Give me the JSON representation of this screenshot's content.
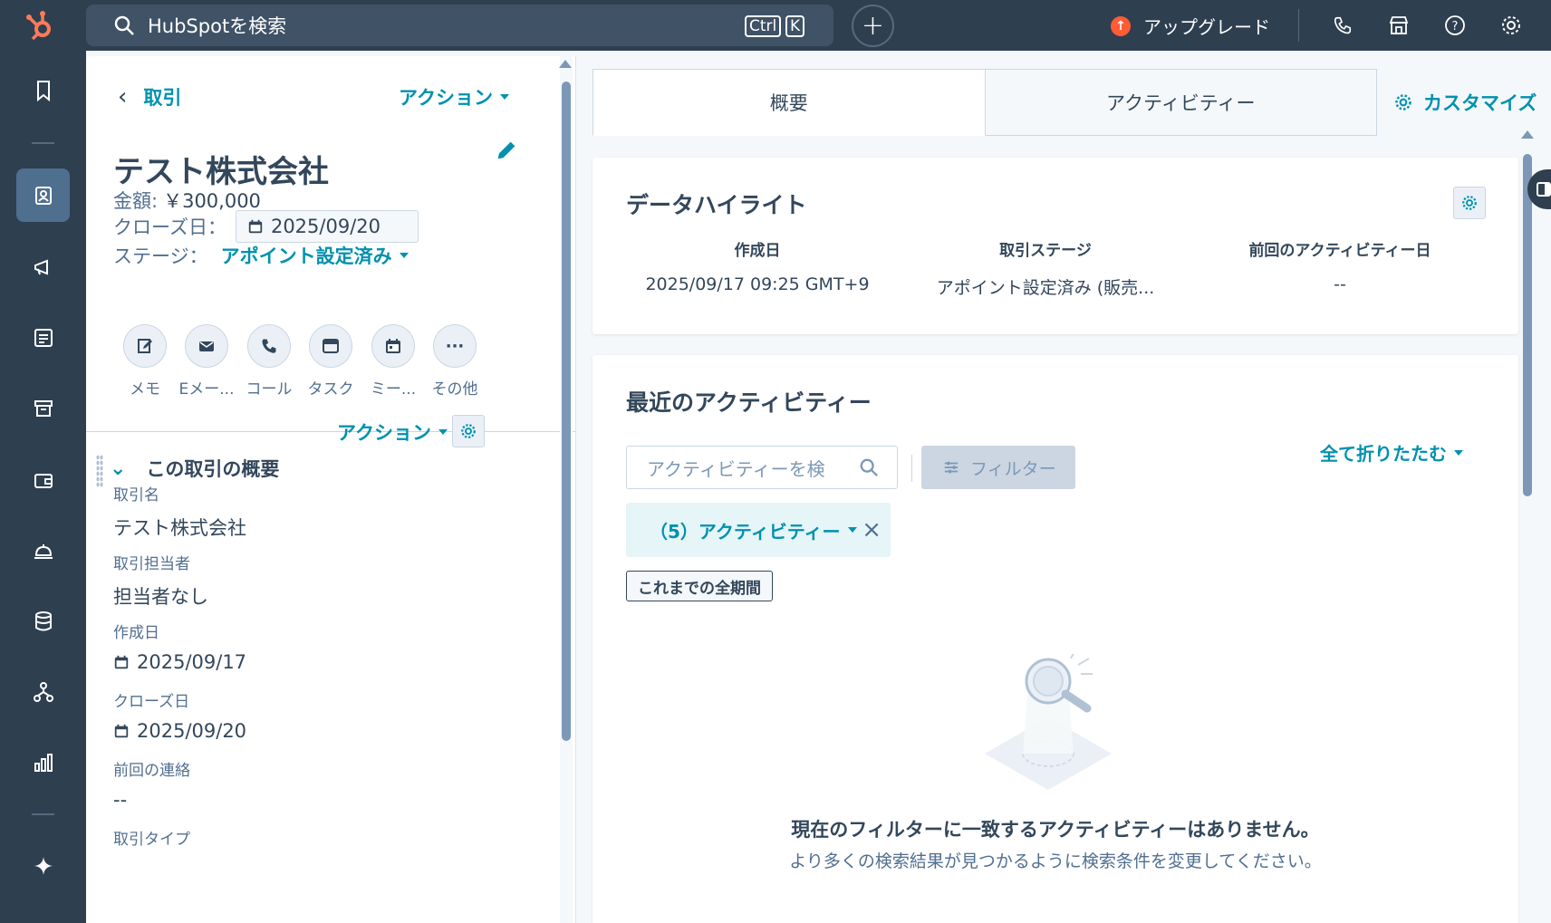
{
  "topbar": {
    "search_text": "HubSpotを検索",
    "kbd_ctrl": "Ctrl",
    "kbd_k": "K",
    "plus": "+",
    "upgrade_label": "アップグレード",
    "upgrade_symbol": "↑"
  },
  "icons": {
    "logo": "hubspot-sprocket-icon",
    "rail": [
      "bookmark-icon",
      "contacts-icon",
      "marketing-megaphone-icon",
      "content-icon",
      "commerce-icon",
      "sales-wallet-icon",
      "service-bell-icon",
      "data-database-icon",
      "automation-icon",
      "reporting-chart-icon",
      "ai-sparkle-icon"
    ]
  },
  "left": {
    "back_label": "取引",
    "back_chevron": "‹",
    "actions_label": "アクション",
    "title": "テスト株式会社",
    "amount_label": "金額:",
    "amount_value": "￥300,000",
    "close_date_label": "クローズ日：",
    "close_date_value": "2025/09/20",
    "stage_label": "ステージ：",
    "stage_value": "アポイント設定済み",
    "activities": [
      {
        "label": "メモ",
        "icon": "note-edit-icon"
      },
      {
        "label": "Eメー...",
        "icon": "email-icon"
      },
      {
        "label": "コール",
        "icon": "phone-icon"
      },
      {
        "label": "タスク",
        "icon": "task-icon"
      },
      {
        "label": "ミー...",
        "icon": "meeting-calendar-icon"
      },
      {
        "label": "その他",
        "icon": "more-icon"
      }
    ],
    "more_glyph": "···",
    "section_chevron": "⌄",
    "section_title": "この取引の概要",
    "section_actions": "アクション",
    "properties": [
      {
        "key": "取引名",
        "value": "テスト株式会社"
      },
      {
        "key": "取引担当者",
        "value": "担当者なし"
      },
      {
        "key": "作成日",
        "value": "2025/09/17"
      },
      {
        "key": "クローズ日",
        "value": "2025/09/20"
      },
      {
        "key": "前回の連絡",
        "value": "--"
      },
      {
        "key": "取引タイプ",
        "value": ""
      }
    ]
  },
  "right": {
    "tabs": [
      "概要",
      "アクティビティー"
    ],
    "customize_label": "カスタマイズ",
    "highlights": {
      "title": "データハイライト",
      "columns": [
        {
          "key": "作成日",
          "value": "2025/09/17 09:25 GMT+9"
        },
        {
          "key": "取引ステージ",
          "value": "アポイント設定済み (販売..."
        },
        {
          "key": "前回のアクティビティー日",
          "value": "--"
        }
      ]
    },
    "recent": {
      "title": "最近のアクティビティー",
      "search_placeholder": "アクティビティーを検",
      "filter_label": "フィルター",
      "collapse_label": "全て折りたたむ",
      "chip_label": "（5）アクティビティー",
      "chip_close": "×",
      "period_label": "これまでの全期間",
      "empty_title": "現在のフィルターに一致するアクティビティーはありません。",
      "empty_sub": "より多くの検索結果が見つかるように検索条件を変更してください。"
    }
  },
  "colors": {
    "nav_bg": "#2e3f50",
    "link": "#0091ae",
    "text": "#33475b",
    "accent_orange": "#ff5c35"
  }
}
